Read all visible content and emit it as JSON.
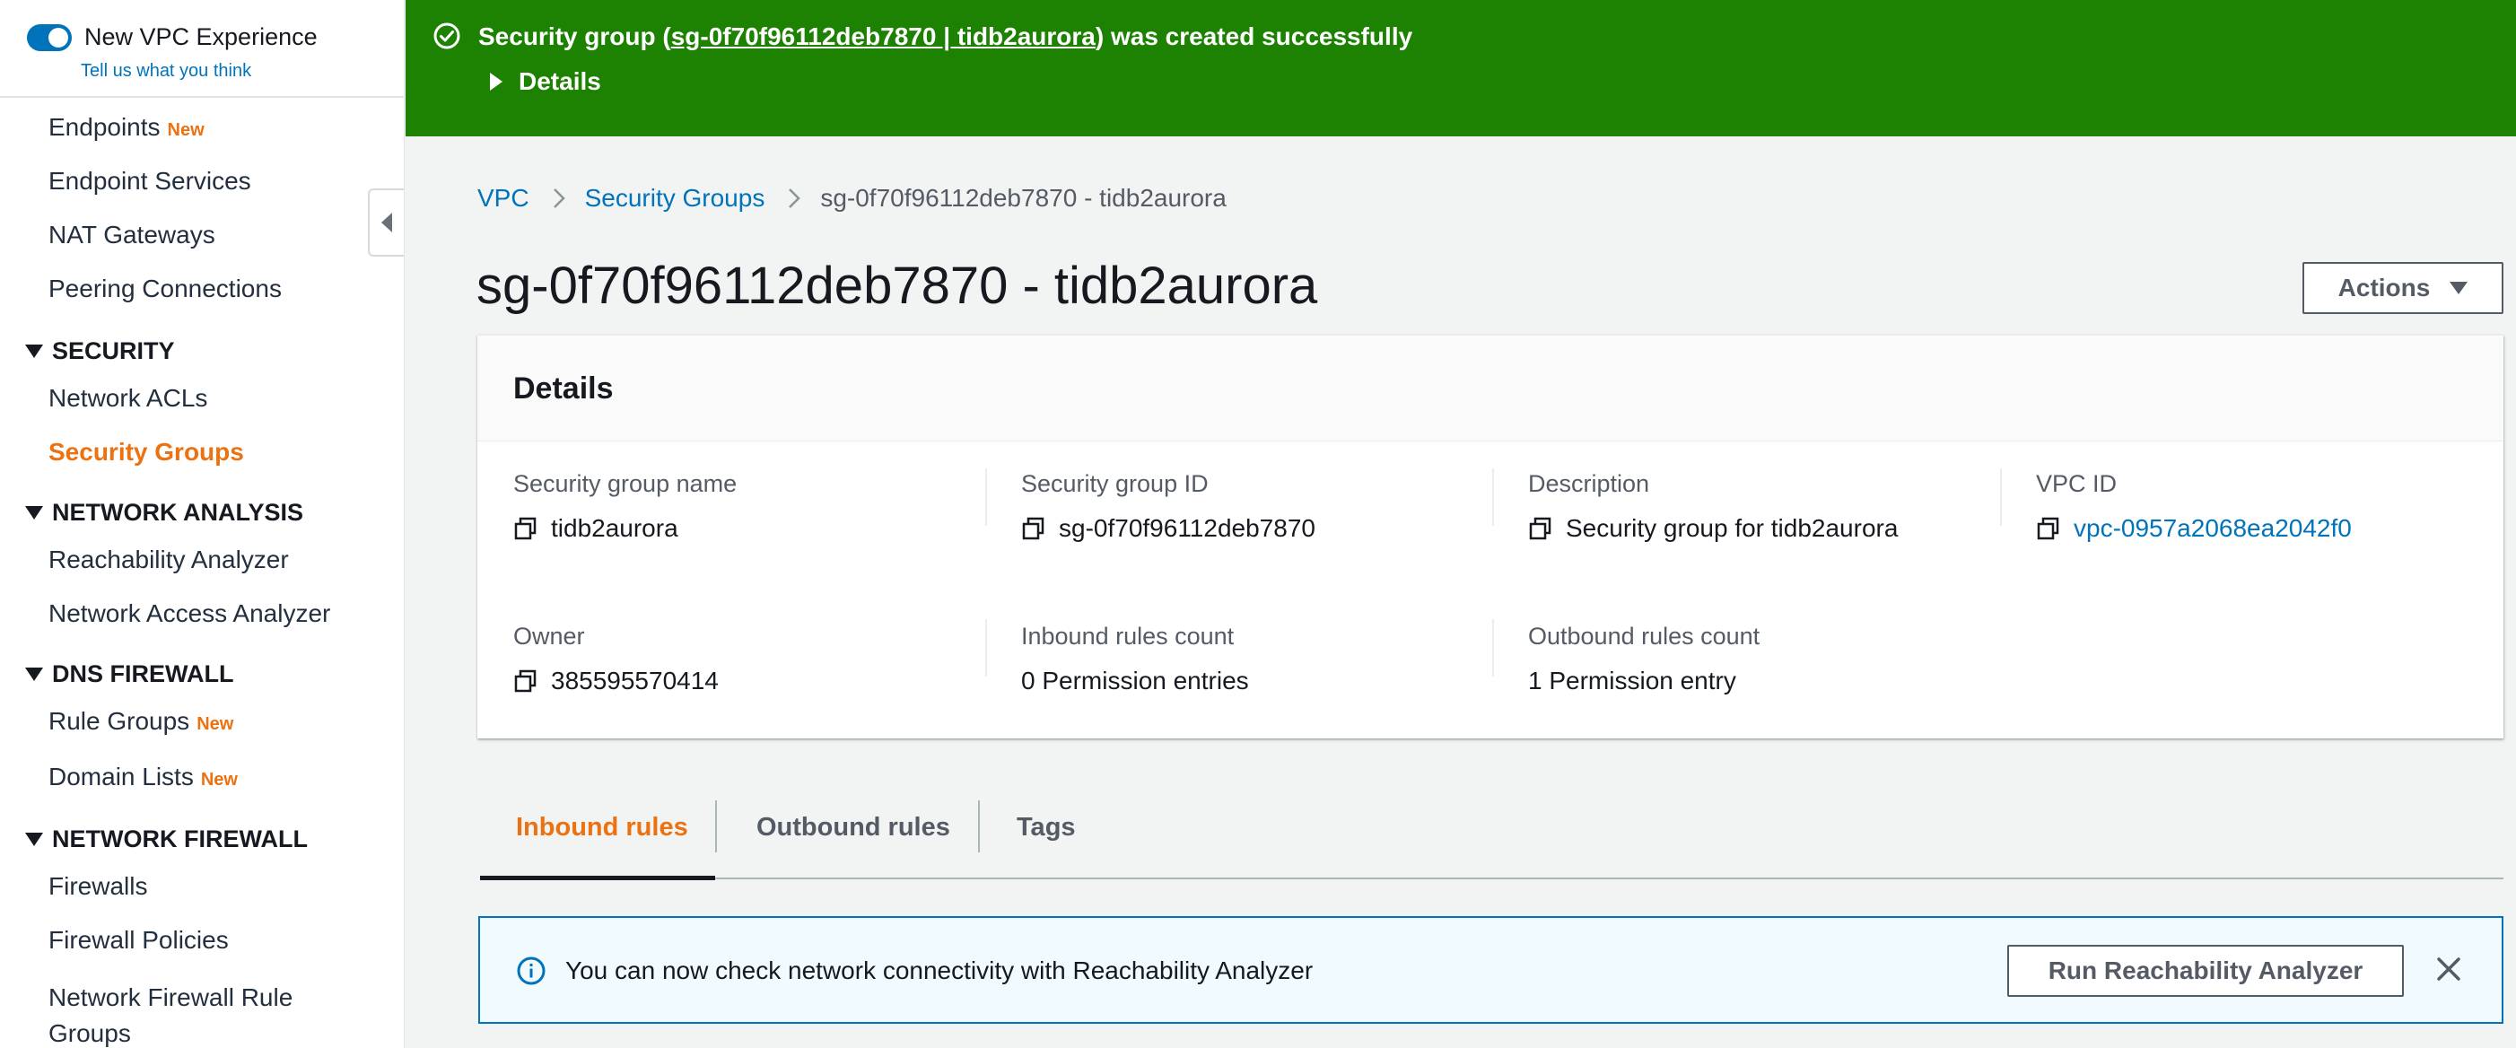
{
  "sidebar": {
    "toggle_label": "New VPC Experience",
    "feedback_link": "Tell us what you think",
    "new_badge": "New",
    "items": {
      "endpoints": "Endpoints",
      "endpoint_services": "Endpoint Services",
      "nat_gateways": "NAT Gateways",
      "peering_connections": "Peering Connections",
      "network_acls": "Network ACLs",
      "security_groups": "Security Groups",
      "reachability_analyzer": "Reachability Analyzer",
      "network_access_analyzer": "Network Access Analyzer",
      "rule_groups": "Rule Groups",
      "domain_lists": "Domain Lists",
      "firewalls": "Firewalls",
      "firewall_policies": "Firewall Policies",
      "network_firewall_rule_groups_1": "Network Firewall Rule",
      "network_firewall_rule_groups_2": "Groups"
    },
    "sections": {
      "security": "SECURITY",
      "network_analysis": "NETWORK ANALYSIS",
      "dns_firewall": "DNS FIREWALL",
      "network_firewall": "NETWORK FIREWALL"
    }
  },
  "flash": {
    "prefix": "Security group (",
    "link": "sg-0f70f96112deb7870 | tidb2aurora",
    "suffix": ") was created successfully",
    "details_label": "Details"
  },
  "breadcrumb": {
    "vpc": "VPC",
    "security_groups": "Security Groups",
    "current": "sg-0f70f96112deb7870 - tidb2aurora"
  },
  "page": {
    "title": "sg-0f70f96112deb7870 - tidb2aurora",
    "actions_label": "Actions"
  },
  "details": {
    "title": "Details",
    "fields": {
      "sg_name": {
        "label": "Security group name",
        "value": "tidb2aurora"
      },
      "sg_id": {
        "label": "Security group ID",
        "value": "sg-0f70f96112deb7870"
      },
      "description": {
        "label": "Description",
        "value": "Security group for tidb2aurora"
      },
      "vpc_id": {
        "label": "VPC ID",
        "value": "vpc-0957a2068ea2042f0"
      },
      "owner": {
        "label": "Owner",
        "value": "385595570414"
      },
      "inbound_count": {
        "label": "Inbound rules count",
        "value": "0 Permission entries"
      },
      "outbound_count": {
        "label": "Outbound rules count",
        "value": "1 Permission entry"
      }
    }
  },
  "tabs": {
    "inbound": "Inbound rules",
    "outbound": "Outbound rules",
    "tags": "Tags"
  },
  "info_alert": {
    "message": "You can now check network connectivity with Reachability Analyzer",
    "button": "Run Reachability Analyzer"
  },
  "colors": {
    "success_green": "#1d8102",
    "link_blue": "#0073bb",
    "active_orange": "#ec7211"
  }
}
